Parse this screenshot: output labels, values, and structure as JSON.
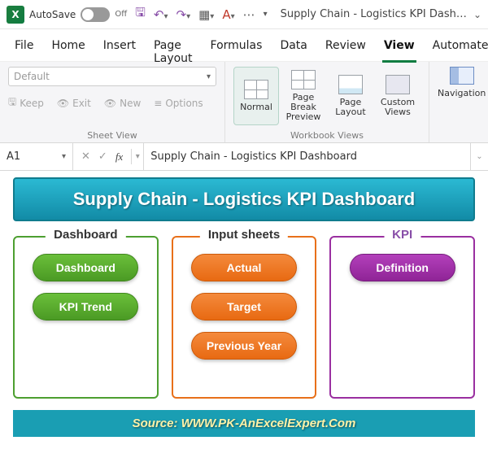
{
  "titlebar": {
    "autosave_label": "AutoSave",
    "autosave_state": "Off",
    "filename": "Supply Chain - Logistics KPI Dashb…"
  },
  "menu": {
    "tabs": [
      "File",
      "Home",
      "Insert",
      "Page Layout",
      "Formulas",
      "Data",
      "Review",
      "View",
      "Automate"
    ],
    "active": "View"
  },
  "ribbon": {
    "sheetview": {
      "dropdown": "Default",
      "keep": "Keep",
      "exit": "Exit",
      "new": "New",
      "options": "Options",
      "group_label": "Sheet View"
    },
    "views": {
      "normal": "Normal",
      "pagebreak": "Page Break Preview",
      "pagelayout": "Page Layout",
      "custom": "Custom Views",
      "group_label": "Workbook Views"
    },
    "nav": {
      "navigation": "Navigation"
    }
  },
  "formulabar": {
    "cellref": "A1",
    "value": "Supply Chain - Logistics KPI Dashboard"
  },
  "dashboard": {
    "banner": "Supply Chain - Logistics KPI Dashboard",
    "groups": [
      {
        "title": "Dashboard",
        "color": "green",
        "pills": [
          "Dashboard",
          "KPI Trend"
        ]
      },
      {
        "title": "Input sheets",
        "color": "orange",
        "pills": [
          "Actual",
          "Target",
          "Previous Year"
        ]
      },
      {
        "title": "KPI",
        "color": "purple",
        "pills": [
          "Definition"
        ]
      }
    ],
    "source": "Source: WWW.PK-AnExcelExpert.Com"
  }
}
